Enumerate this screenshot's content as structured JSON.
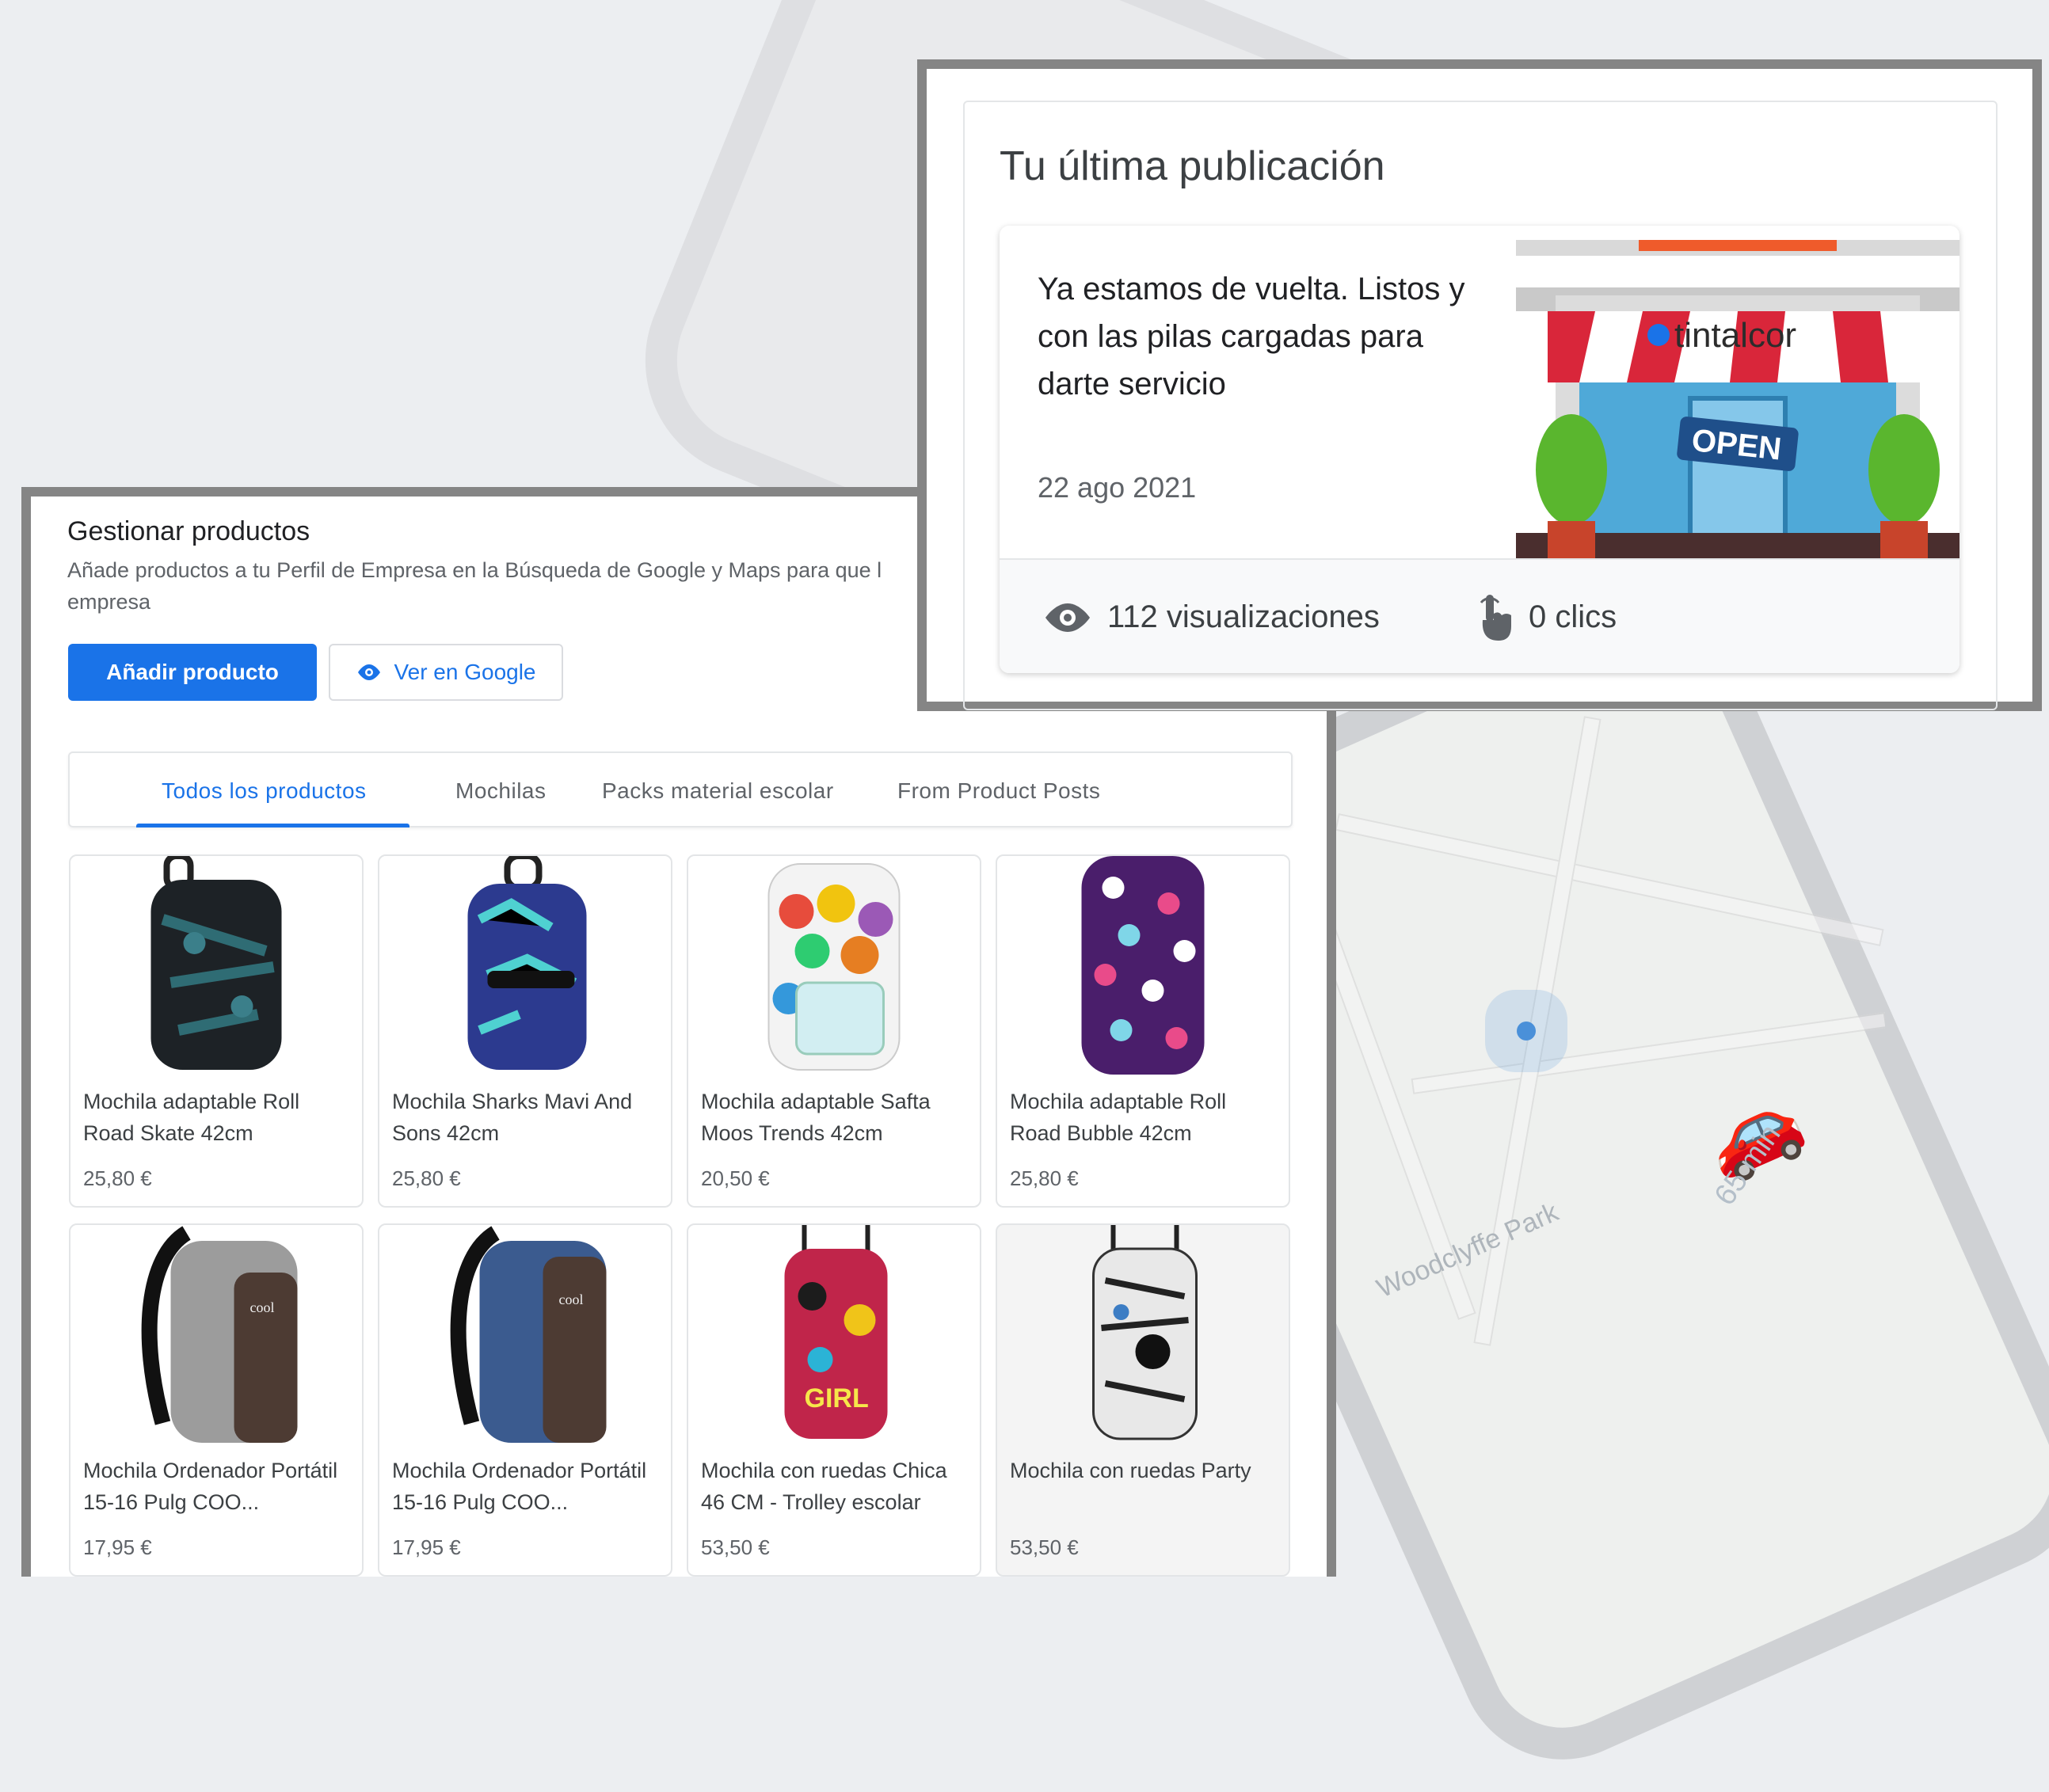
{
  "products_panel": {
    "title": "Gestionar productos",
    "description": "Añade productos a tu Perfil de Empresa en la Búsqueda de Google y Maps para que l",
    "description_2": "empresa",
    "add_button": "Añadir producto",
    "view_button": "Ver en Google",
    "tabs": [
      {
        "label": "Todos los productos",
        "active": true
      },
      {
        "label": "Mochilas",
        "active": false
      },
      {
        "label": "Packs material escolar",
        "active": false
      },
      {
        "label": "From Product Posts",
        "active": false
      }
    ],
    "products": [
      {
        "name": "Mochila adaptable Roll Road Skate 42cm",
        "price": "25,80 €"
      },
      {
        "name": "Mochila Sharks Mavi And Sons 42cm",
        "price": "25,80 €"
      },
      {
        "name": "Mochila adaptable Safta Moos Trends 42cm",
        "price": "20,50 €"
      },
      {
        "name": "Mochila adaptable Roll Road Bubble 42cm",
        "price": "25,80 €"
      },
      {
        "name": "Mochila Ordenador Portátil 15-16 Pulg COO...",
        "price": "17,95 €"
      },
      {
        "name": "Mochila Ordenador Portátil 15-16 Pulg COO...",
        "price": "17,95 €"
      },
      {
        "name": "Mochila con ruedas Chica 46 CM - Trolley escolar",
        "price": "53,50 €"
      },
      {
        "name": "Mochila con ruedas Party",
        "price": "53,50 €"
      }
    ]
  },
  "post_panel": {
    "title": "Tu última publicación",
    "text": "Ya estamos de vuelta. Listos y con las pilas cargadas para darte servicio",
    "date": "22 ago 2021",
    "image_logo": "tintalcor",
    "image_sign": "OPEN",
    "views": "112 visualizaciones",
    "clicks": "0 clics"
  },
  "background": {
    "map_place": "Woodclyffe Park",
    "eta": "65 min"
  },
  "colors": {
    "accent": "#1a73e8",
    "frame": "#858585"
  }
}
